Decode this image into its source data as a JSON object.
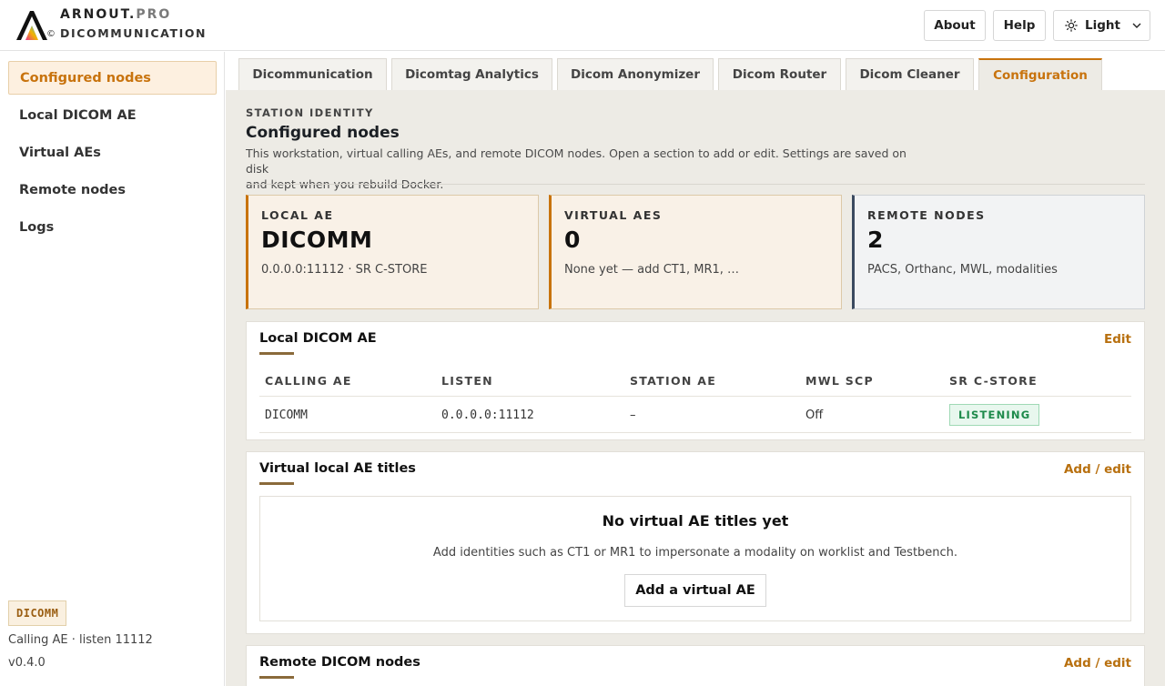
{
  "header": {
    "brand_main": "ARNOUT.",
    "brand_suffix": "PRO",
    "copyright": "©",
    "product": "DICOMMUNICATION",
    "buttons": {
      "about": "About",
      "help": "Help",
      "theme": "Light"
    },
    "icons": {
      "theme": "sun-icon",
      "dropdown": "chevron-down-icon"
    }
  },
  "sidebar": {
    "items": [
      {
        "label": "Configured nodes",
        "active": true
      },
      {
        "label": "Local DICOM AE",
        "active": false
      },
      {
        "label": "Virtual AEs",
        "active": false
      },
      {
        "label": "Remote nodes",
        "active": false
      },
      {
        "label": "Logs",
        "active": false
      }
    ],
    "badge": "DICOMM",
    "meta": "Calling AE · listen 11112",
    "version": "v0.4.0"
  },
  "tabs": [
    {
      "label": "Dicommunication",
      "active": false
    },
    {
      "label": "Dicomtag Analytics",
      "active": false
    },
    {
      "label": "Dicom Anonymizer",
      "active": false
    },
    {
      "label": "Dicom Router",
      "active": false
    },
    {
      "label": "Dicom Cleaner",
      "active": false
    },
    {
      "label": "Configuration",
      "active": true
    }
  ],
  "page": {
    "eyebrow": "STATION IDENTITY",
    "title": "Configured nodes",
    "description_line1": "This workstation, virtual calling AEs, and remote DICOM nodes. Open a section to add or edit. Settings are saved on disk",
    "description_line2": "and kept when you rebuild Docker."
  },
  "stats": [
    {
      "label": "LOCAL AE",
      "value": "DICOMM",
      "sub": "0.0.0.0:11112 · SR C-STORE"
    },
    {
      "label": "VIRTUAL AES",
      "value": "0",
      "sub": "None yet — add CT1, MR1, …"
    },
    {
      "label": "REMOTE NODES",
      "value": "2",
      "sub": "PACS, Orthanc, MWL, modalities"
    }
  ],
  "local_ae": {
    "title": "Local DICOM AE",
    "action": "Edit",
    "columns": [
      "CALLING AE",
      "LISTEN",
      "STATION AE",
      "MWL SCP",
      "SR C-STORE"
    ],
    "row": {
      "calling_ae": "DICOMM",
      "listen": "0.0.0.0:11112",
      "station_ae": "–",
      "mwl_scp": "Off",
      "sr_cstore": "LISTENING"
    }
  },
  "virtual_ae": {
    "title": "Virtual local AE titles",
    "action": "Add / edit",
    "empty_title": "No virtual AE titles yet",
    "empty_desc": "Add identities such as CT1 or MR1 to impersonate a modality on worklist and Testbench.",
    "empty_button": "Add a virtual AE"
  },
  "remote_nodes": {
    "title": "Remote DICOM nodes",
    "action": "Add / edit"
  },
  "colors": {
    "accent": "#c8730d",
    "status_green": "#1d8a4a",
    "background": "#edebe5"
  }
}
